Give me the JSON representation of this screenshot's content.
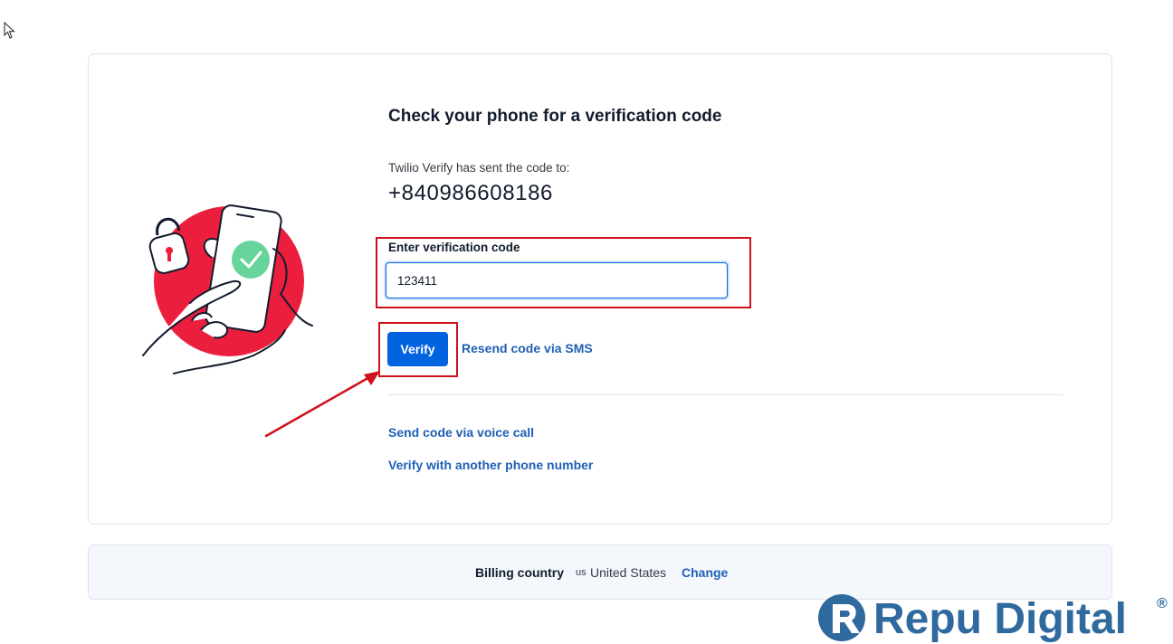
{
  "page": {
    "heading": "Check your phone for a verification code",
    "sent_text": "Twilio Verify has sent the code to:",
    "phone_number": "+840986608186"
  },
  "form": {
    "code_label": "Enter verification code",
    "code_value": "123411",
    "verify_label": "Verify",
    "resend_label": "Resend code via SMS"
  },
  "alternatives": {
    "voice_call_label": "Send code via voice call",
    "other_phone_label": "Verify with another phone number"
  },
  "billing": {
    "label": "Billing country",
    "country_code": "us",
    "country_name": "United States",
    "change_label": "Change"
  },
  "watermark": {
    "text": "Repu Digital",
    "registered_mark": "®"
  },
  "colors": {
    "primary": "#0263e0",
    "link": "#1f5fb5",
    "highlight": "#d0101a",
    "illustration_circle": "#eb1f3d",
    "check_green": "#67d49c",
    "watermark": "#2f6a9e"
  },
  "icons": {
    "cursor": "mouse-pointer-icon",
    "illustration": "phone-verification-illustration",
    "annotation": "red-arrow-icon"
  }
}
